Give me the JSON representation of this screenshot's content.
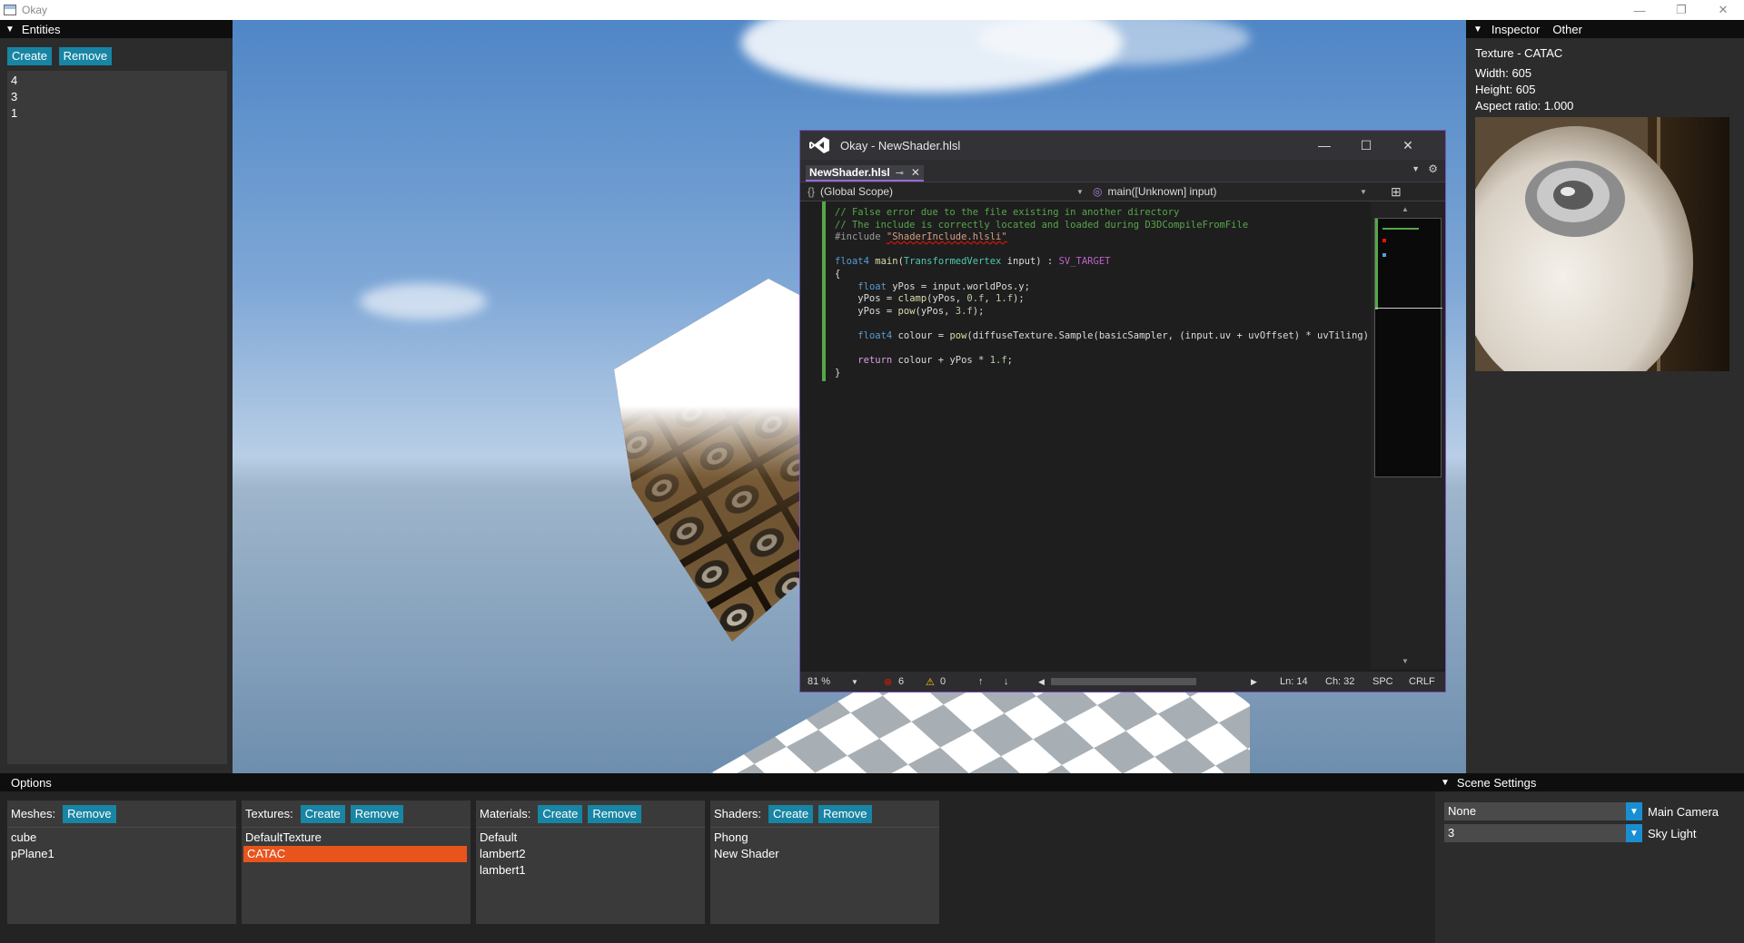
{
  "window": {
    "title": "Okay",
    "minimize": "—",
    "restore": "❐",
    "close": "✕"
  },
  "entities": {
    "header": "Entities",
    "create_label": "Create",
    "remove_label": "Remove",
    "items": [
      "4",
      "3",
      "1"
    ]
  },
  "inspector": {
    "tabs": [
      "Inspector",
      "Other"
    ],
    "texture_title": "Texture - CATAC",
    "width": "Width: 605",
    "height": "Height: 605",
    "aspect": "Aspect ratio: 1.000"
  },
  "vs": {
    "title": "Okay - NewShader.hlsl",
    "tab": "NewShader.hlsl",
    "tab_pin": "⊸",
    "tab_close": "✕",
    "scope": "(Global Scope)",
    "function": "main([Unknown] input)",
    "status": {
      "zoom": "81 %",
      "errors": "6",
      "warnings": "0",
      "line": "Ln: 14",
      "char": "Ch: 32",
      "spc": "SPC",
      "crlf": "CRLF"
    }
  },
  "options": {
    "header": "Options",
    "meshes": {
      "label": "Meshes:",
      "remove_label": "Remove",
      "items": [
        "cube",
        "pPlane1"
      ]
    },
    "textures": {
      "label": "Textures:",
      "create_label": "Create",
      "remove_label": "Remove",
      "items": [
        "DefaultTexture",
        "CATAC"
      ],
      "selected": "CATAC"
    },
    "materials": {
      "label": "Materials:",
      "create_label": "Create",
      "remove_label": "Remove",
      "items": [
        "Default",
        "lambert2",
        "lambert1"
      ]
    },
    "shaders": {
      "label": "Shaders:",
      "create_label": "Create",
      "remove_label": "Remove",
      "items": [
        "Phong",
        "New Shader"
      ]
    }
  },
  "scene": {
    "header": "Scene Settings",
    "main_camera_value": "None",
    "main_camera_label": "Main Camera",
    "sky_light_value": "3",
    "sky_light_label": "Sky Light"
  },
  "colors": {
    "button": "#1885a4",
    "selected": "#e8541c",
    "vs_accent": "#7a4fbf",
    "dropdown": "#1a8ed2"
  }
}
